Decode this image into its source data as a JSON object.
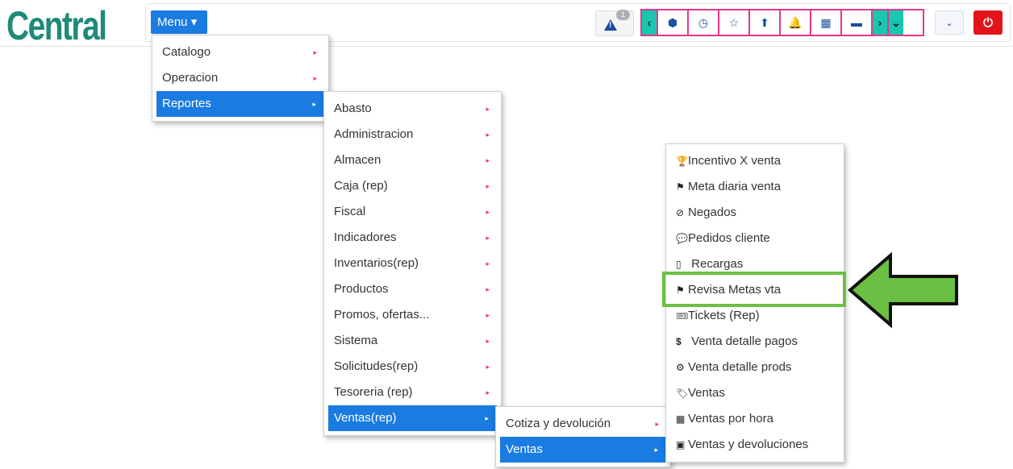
{
  "app": {
    "logo_text": "Central"
  },
  "header": {
    "menu_label": "Menu ▾",
    "alert_badge": "1",
    "tools": [
      {
        "icon": "chevron-left-icon",
        "glyph": "‹"
      },
      {
        "icon": "cube-icon",
        "glyph": "⬢"
      },
      {
        "icon": "clock-icon",
        "glyph": "◷"
      },
      {
        "icon": "star-icon",
        "glyph": "☆"
      },
      {
        "icon": "arrow-up-icon",
        "glyph": "⬆"
      },
      {
        "icon": "bell-icon",
        "glyph": "🔔"
      },
      {
        "icon": "calendar-icon",
        "glyph": "▦"
      },
      {
        "icon": "card-icon",
        "glyph": "▬"
      },
      {
        "icon": "chevron-right-icon",
        "glyph": "›"
      },
      {
        "icon": "chevron-down-icon",
        "glyph": "⌄"
      }
    ],
    "collapse_glyph": "⌄",
    "power_glyph": "⏻"
  },
  "menu_level1": {
    "items": [
      "Catalogo",
      "Operacion",
      "Reportes"
    ],
    "active": "Reportes"
  },
  "menu_level2": {
    "items": [
      "Abasto",
      "Administracion",
      "Almacen",
      "Caja (rep)",
      "Fiscal",
      "Indicadores",
      "Inventarios(rep)",
      "Productos",
      "Promos, ofertas...",
      "Sistema",
      "Solicitudes(rep)",
      "Tesoreria (rep)",
      "Ventas(rep)"
    ],
    "active": "Ventas(rep)"
  },
  "menu_level3": {
    "items": [
      "Cotiza y devolución",
      "Ventas"
    ],
    "active": "Ventas"
  },
  "menu_level4": {
    "items": [
      {
        "label": "Incentivo X venta",
        "icon": "trophy-icon",
        "glyph": "🏆"
      },
      {
        "label": "Meta diaria venta",
        "icon": "flag-icon",
        "glyph": "⚑"
      },
      {
        "label": "Negados",
        "icon": "denied-icon",
        "glyph": "⊘"
      },
      {
        "label": "Pedidos cliente",
        "icon": "comment-icon",
        "glyph": "💬"
      },
      {
        "label": " Recargas",
        "icon": "phone-icon",
        "glyph": "▯"
      },
      {
        "label": "Revisa Metas vta",
        "icon": "flag-icon",
        "glyph": "⚑"
      },
      {
        "label": "Tickets (Rep)",
        "icon": "ticket-icon",
        "glyph": "🎟"
      },
      {
        "label": " Venta detalle pagos",
        "icon": "dollar-icon",
        "glyph": "$"
      },
      {
        "label": "Venta detalle prods",
        "icon": "product-icon",
        "glyph": "⚙"
      },
      {
        "label": "Ventas",
        "icon": "tag-icon",
        "glyph": "🏷"
      },
      {
        "label": "Ventas por hora",
        "icon": "calendar-icon",
        "glyph": "▦"
      },
      {
        "label": "Ventas y devoluciones",
        "icon": "money-icon",
        "glyph": "▣"
      }
    ],
    "highlighted": "Revisa Metas vta"
  },
  "colors": {
    "accent": "#1a7be0",
    "pink": "#e8368a",
    "teal": "#17c7b0",
    "highlight": "#6bc043",
    "power": "#e3141b",
    "logo": "#1f8a7a"
  }
}
